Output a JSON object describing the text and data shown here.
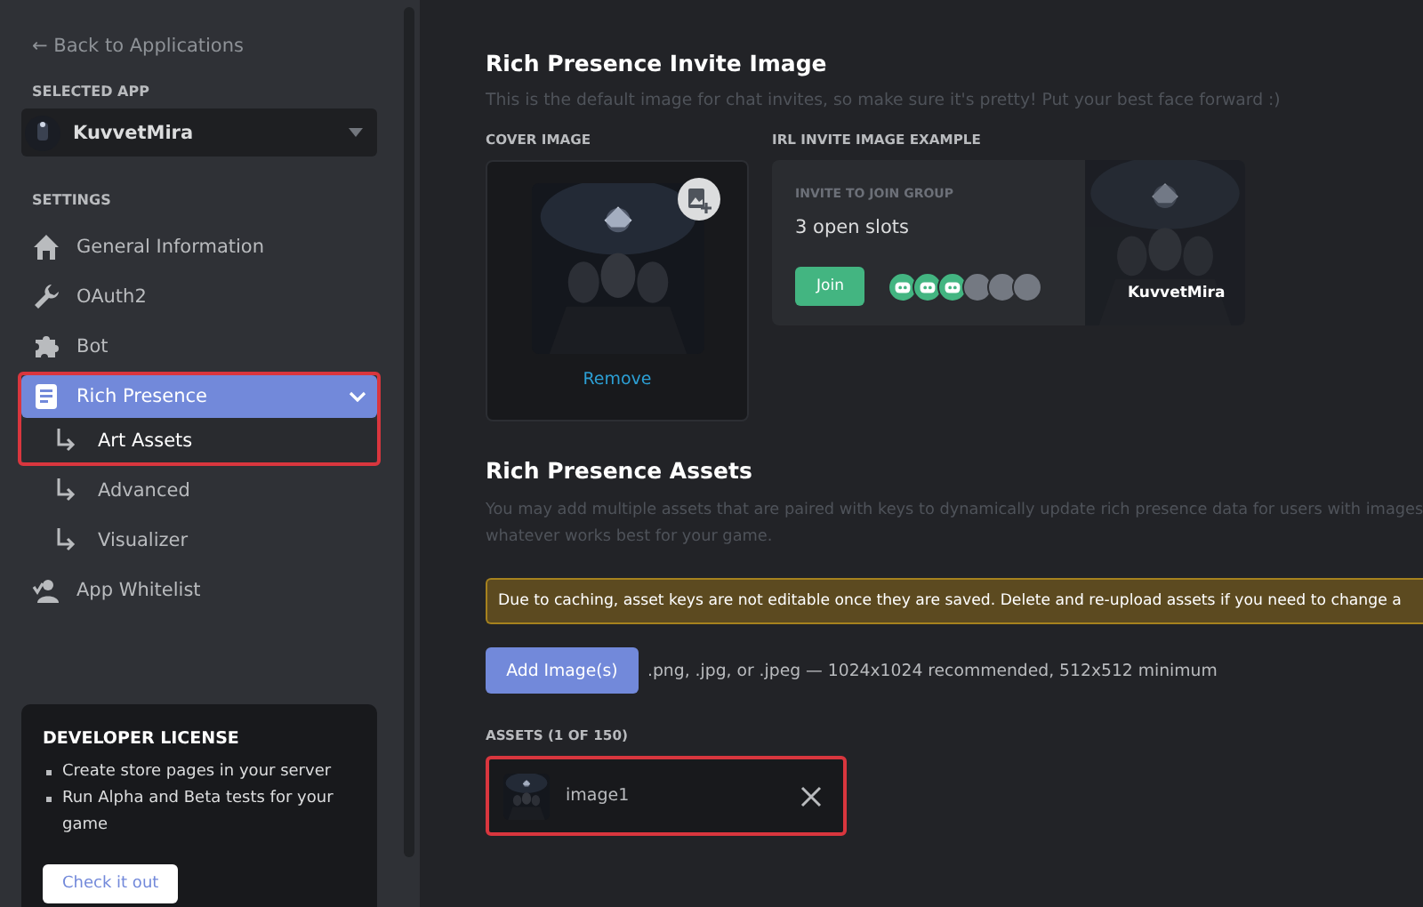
{
  "sidebar": {
    "back_link": "← Back to Applications",
    "selected_app_label": "SELECTED APP",
    "selected_app": {
      "name": "KuvvetMira"
    },
    "settings_label": "SETTINGS",
    "items": [
      {
        "label": "General Information",
        "selected": false,
        "highlighted": false
      },
      {
        "label": "OAuth2",
        "selected": false,
        "highlighted": false
      },
      {
        "label": "Bot",
        "selected": false,
        "highlighted": false
      },
      {
        "label": "Rich Presence",
        "selected": true,
        "expanded": true,
        "highlighted": true,
        "children": [
          {
            "label": "Art Assets",
            "selected": true,
            "highlighted": true
          },
          {
            "label": "Advanced",
            "selected": false,
            "highlighted": false
          },
          {
            "label": "Visualizer",
            "selected": false,
            "highlighted": false
          }
        ]
      },
      {
        "label": "App Whitelist",
        "selected": false,
        "highlighted": false
      }
    ],
    "license_card": {
      "title": "DEVELOPER LICENSE",
      "bullets": [
        "Create store pages in your server",
        "Run Alpha and Beta tests for your game"
      ],
      "button": "Check it out"
    }
  },
  "invite_image": {
    "title": "Rich Presence Invite Image",
    "description": "This is the default image for chat invites, so make sure it's pretty! Put your best face forward :)",
    "cover_label": "COVER IMAGE",
    "cover": {
      "kind": "picture",
      "remove_link": "Remove"
    },
    "example_label": "IRL INVITE IMAGE EXAMPLE",
    "example": {
      "heading": "INVITE TO JOIN GROUP",
      "slots_text": "3 open slots",
      "join_button": "Join",
      "slots": [
        {
          "filled": true
        },
        {
          "filled": true
        },
        {
          "filled": true
        },
        {
          "filled": false
        },
        {
          "filled": false
        },
        {
          "filled": false
        }
      ],
      "app_name": "KuvvetMira"
    }
  },
  "assets": {
    "title": "Rich Presence Assets",
    "description": [
      "You may add multiple assets that are paired with keys to dynamically update rich presence data for users with images",
      "whatever works best for your game."
    ],
    "warning": "Due to caching, asset keys are not editable once they are saved. Delete and re-upload assets if you need to change a",
    "add_button": "Add Image(s)",
    "format_hint": ".png, .jpg, or .jpeg — 1024x1024 recommended, 512x512 minimum",
    "list_label": "ASSETS (1 OF 150)",
    "items": [
      {
        "name": "image1",
        "highlighted": true
      }
    ]
  }
}
